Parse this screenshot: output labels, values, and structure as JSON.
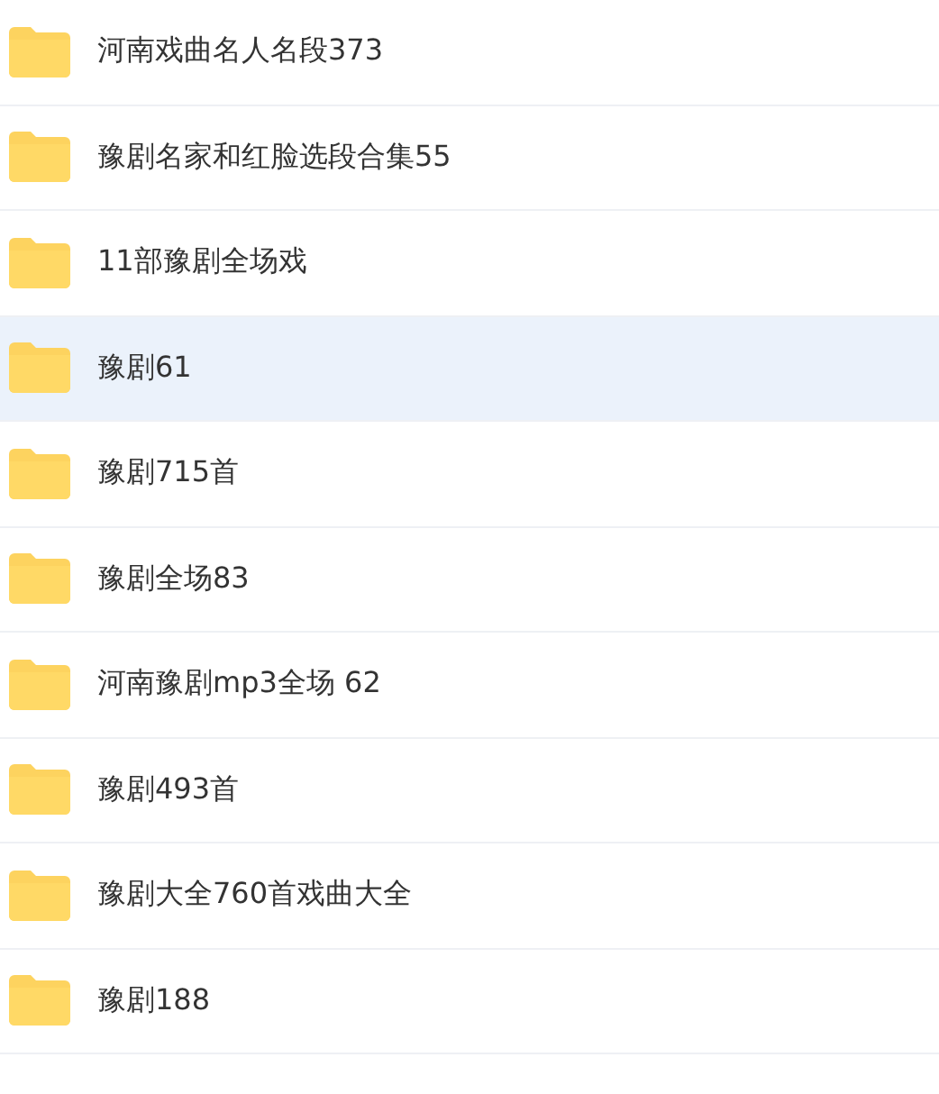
{
  "folders": [
    {
      "name": "河南戏曲名人名段373",
      "selected": false
    },
    {
      "name": "豫剧名家和红脸选段合集55",
      "selected": false
    },
    {
      "name": "11部豫剧全场戏",
      "selected": false
    },
    {
      "name": "豫剧61",
      "selected": true
    },
    {
      "name": "豫剧715首",
      "selected": false
    },
    {
      "name": "豫剧全场83",
      "selected": false
    },
    {
      "name": "河南豫剧mp3全场 62",
      "selected": false
    },
    {
      "name": "豫剧493首",
      "selected": false
    },
    {
      "name": "豫剧大全760首戏曲大全",
      "selected": false
    },
    {
      "name": "豫剧188",
      "selected": false
    }
  ]
}
